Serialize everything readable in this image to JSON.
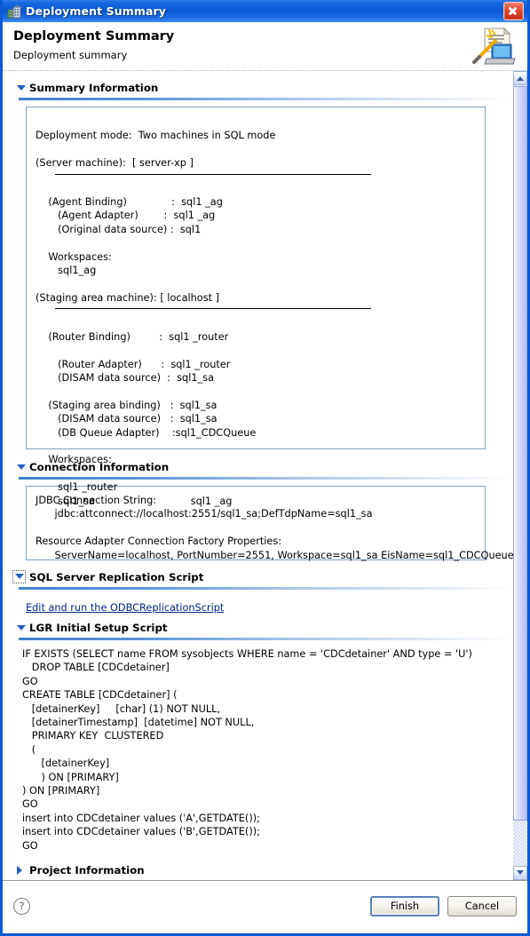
{
  "window": {
    "title": "Deployment Summary",
    "title_icon": "server-building-icon",
    "close_icon": "close-icon",
    "accent_color": "#0a58d4"
  },
  "header": {
    "title": "Deployment Summary",
    "subtitle": "Deployment summary",
    "wizard_icon": "wizard-laptop-document-icon"
  },
  "sections": {
    "summary": {
      "label": "Summary Information",
      "expanded": true,
      "toggle_icon": "triangle-down-icon",
      "deployment_mode_label": "Deployment mode:",
      "deployment_mode_value": "Two machines in SQL mode",
      "server_machine_label": "(Server machine):",
      "server_machine_value": "[ server-xp ]",
      "block1": "    (Agent Binding)              :  sql1 _ag\n       (Agent Adapter)        :  sql1 _ag\n       (Original data source) :  sql1\n\n    Workspaces:\n       sql1_ag",
      "staging_machine_label": "(Staging area machine):",
      "staging_machine_value": "[ localhost ]",
      "block2": "    (Router Binding)         :  sql1 _router\n\n       (Router Adapter)      :  sql1 _router\n       (DISAM data source)  :  sql1_sa\n\n    (Staging area binding)   :  sql1_sa\n       (DISAM data source)   :  sql1_sa\n       (DB Queue Adapter)    :sql1_CDCQueue\n\n    Workspaces:\n\n       sql1 _router\n       sql1_sa                              sql1 _ag"
    },
    "connection": {
      "label": "Connection Information",
      "expanded": true,
      "toggle_icon": "triangle-down-icon",
      "text": "JDBC Connection String:\n      jdbc:attconnect://localhost:2551/sql1_sa;DefTdpName=sql1_sa\n\nResource Adapter Connection Factory Properties:\n      ServerName=localhost, PortNumber=2551, Workspace=sql1_sa EisName=sql1_CDCQueue"
    },
    "replication": {
      "label": "SQL Server Replication Script",
      "expanded": true,
      "focused": true,
      "toggle_icon": "triangle-down-icon-focused",
      "link_text": "Edit and run the ODBCReplicationScript",
      "link_color": "#00258c"
    },
    "lgr": {
      "label": "LGR Initial Setup Script",
      "expanded": true,
      "toggle_icon": "triangle-down-icon",
      "script": "IF EXISTS (SELECT name FROM sysobjects WHERE name = 'CDCdetainer' AND type = 'U')\n   DROP TABLE [CDCdetainer]\nGO\nCREATE TABLE [CDCdetainer] (\n   [detainerKey]     [char] (1) NOT NULL,\n   [detainerTimestamp]  [datetime] NOT NULL,\n   PRIMARY KEY  CLUSTERED\n   (\n      [detainerKey]\n      ) ON [PRIMARY]\n) ON [PRIMARY]\nGO\ninsert into CDCdetainer values ('A',GETDATE());\ninsert into CDCdetainer values ('B',GETDATE());\nGO"
    },
    "project": {
      "label": "Project Information",
      "expanded": false,
      "toggle_icon": "triangle-right-icon"
    }
  },
  "scrollbar": {
    "up_icon": "scroll-up-arrow-icon",
    "down_icon": "scroll-down-arrow-icon",
    "thumb": "scrollbar-thumb"
  },
  "footer": {
    "help_icon": "?",
    "finish_label": "Finish",
    "cancel_label": "Cancel"
  }
}
